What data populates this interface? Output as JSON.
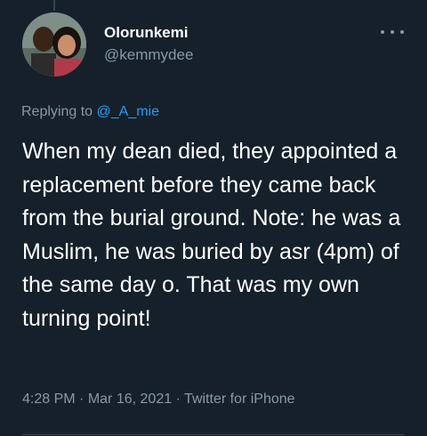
{
  "tweet": {
    "author": {
      "display_name": "Olorunkemi",
      "handle": "@kemmydee",
      "avatar_icon": "profile-photo"
    },
    "more_icon": "more-horizontal-icon",
    "reply": {
      "prefix": "Replying to",
      "mention": "@_A_mie"
    },
    "text": "When my dean died, they appointed a replacement before they came back from the burial ground. Note: he was a Muslim, he was buried by asr (4pm) of the same day o. That was my own turning point!",
    "meta": {
      "time": "4:28 PM",
      "separator": "·",
      "date": "Mar 16, 2021",
      "source": "Twitter for iPhone"
    }
  },
  "colors": {
    "background": "#15202b",
    "primary_text": "#ffffff",
    "secondary_text": "#8899a6",
    "accent": "#1da1f2",
    "divider": "#38444d"
  }
}
